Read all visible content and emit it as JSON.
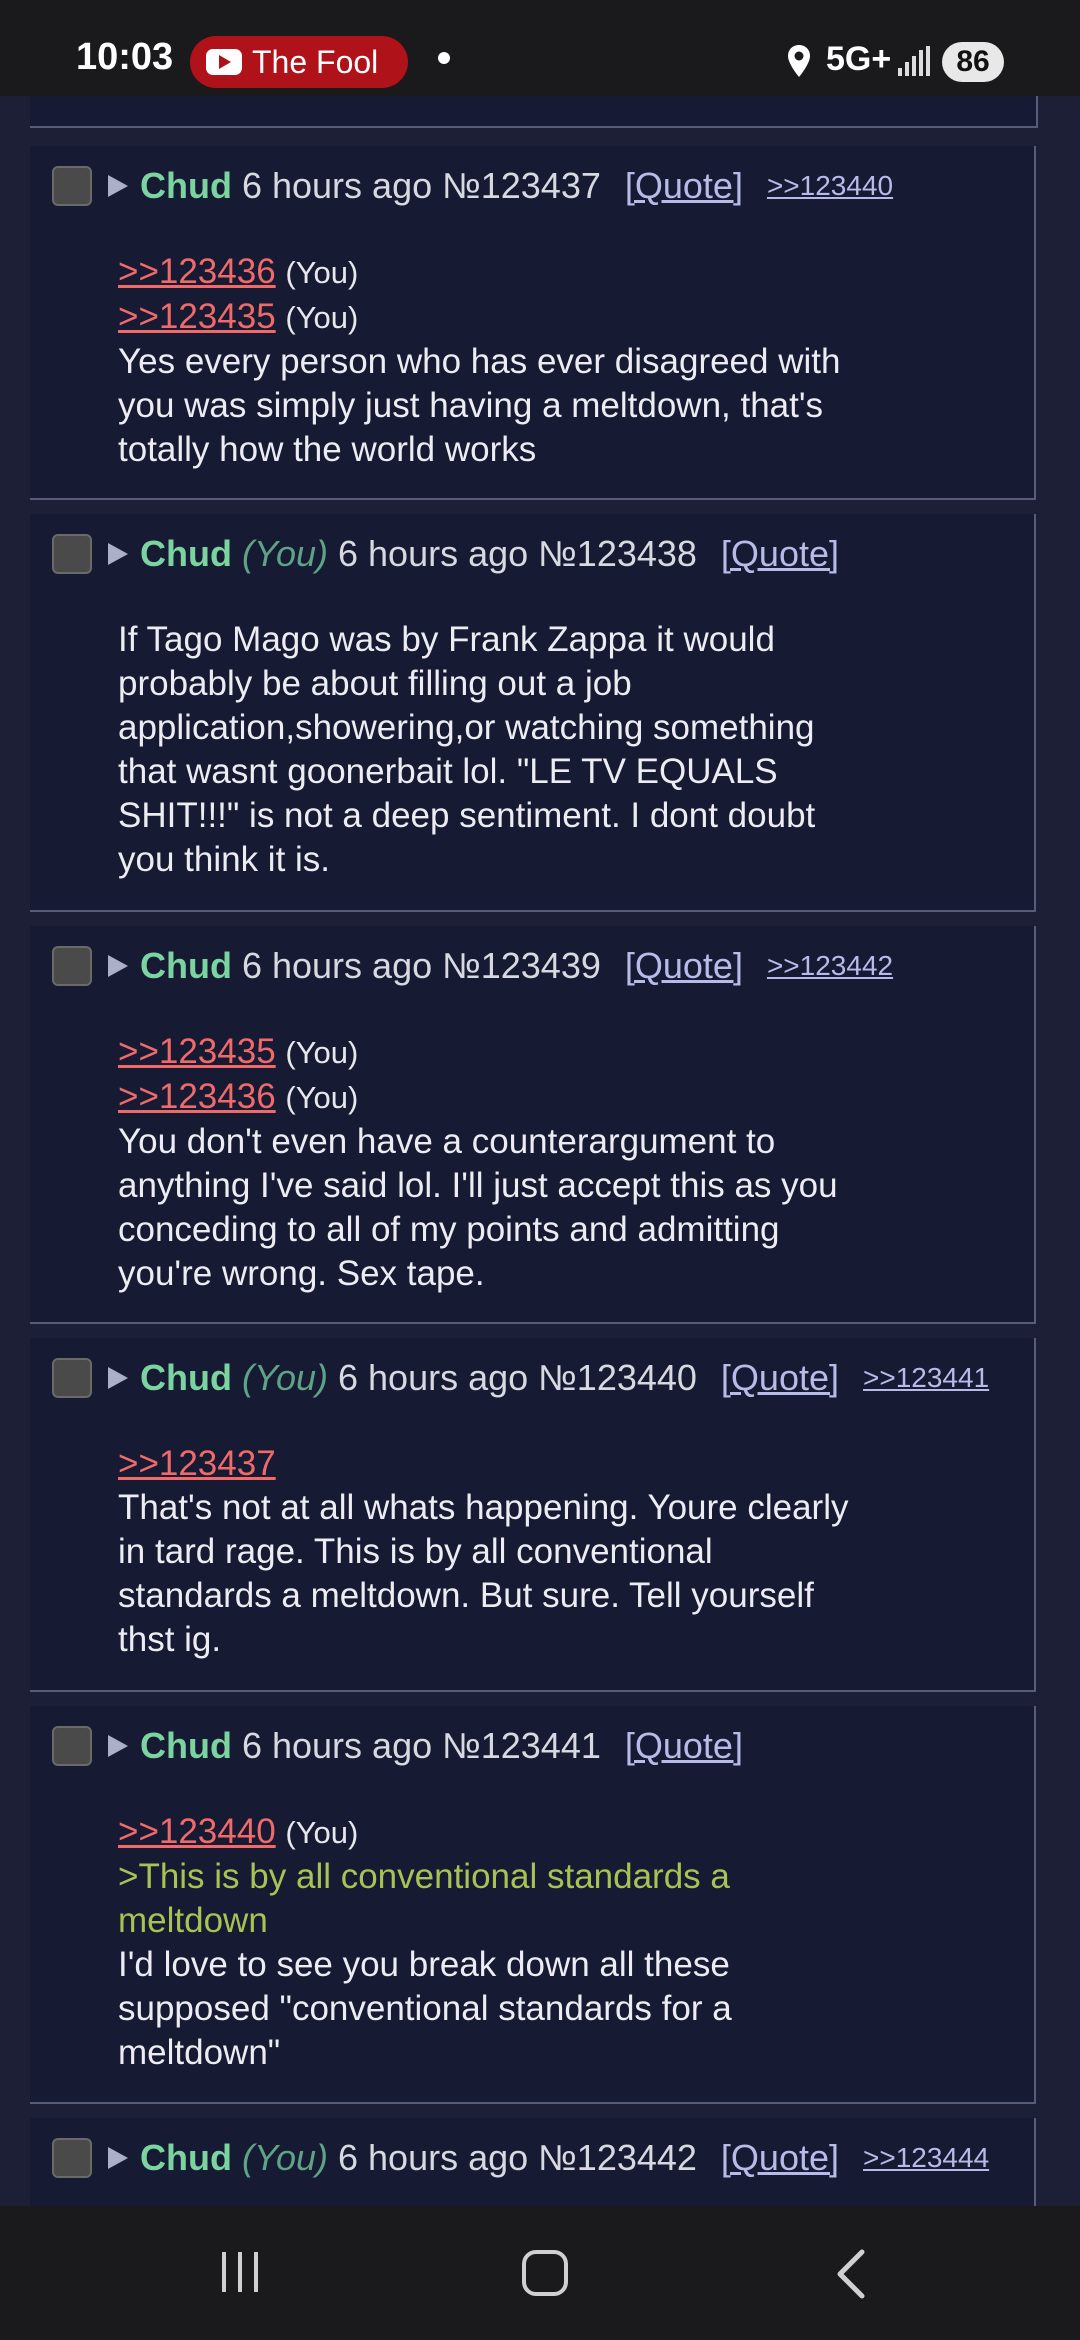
{
  "status_bar": {
    "time": "10:03",
    "notification_app": "The Fool",
    "network": "5G+",
    "battery": "86"
  },
  "posts": [
    {
      "name": "Chud",
      "you": "",
      "time": "6 hours ago",
      "number": "№123437",
      "quote_label": "[Quote]",
      "backlinks": [
        ">>123440"
      ],
      "lines": [
        {
          "type": "quote",
          "text": ">>123436",
          "suffix": "(You)"
        },
        {
          "type": "quote",
          "text": ">>123435",
          "suffix": "(You)"
        },
        {
          "type": "text",
          "text": "Yes every person who has ever disagreed with"
        },
        {
          "type": "text",
          "text": "you was simply just having a meltdown, that's"
        },
        {
          "type": "text",
          "text": "totally how the world works"
        }
      ]
    },
    {
      "name": "Chud",
      "you": "(You)",
      "time": "6 hours ago",
      "number": "№123438",
      "quote_label": "[Quote]",
      "backlinks": [],
      "lines": [
        {
          "type": "text",
          "text": "If Tago Mago was by Frank Zappa it would"
        },
        {
          "type": "text",
          "text": "probably be about filling out a job"
        },
        {
          "type": "text",
          "text": "application,showering,or watching something"
        },
        {
          "type": "text",
          "text": "that wasnt goonerbait lol. \"LE TV EQUALS"
        },
        {
          "type": "text",
          "text": "SHIT!!!\" is not a deep sentiment. I dont doubt"
        },
        {
          "type": "text",
          "text": "you think it is."
        }
      ]
    },
    {
      "name": "Chud",
      "you": "",
      "time": "6 hours ago",
      "number": "№123439",
      "quote_label": "[Quote]",
      "backlinks": [
        ">>123442"
      ],
      "lines": [
        {
          "type": "quote",
          "text": ">>123435",
          "suffix": "(You)"
        },
        {
          "type": "quote",
          "text": ">>123436",
          "suffix": "(You)"
        },
        {
          "type": "text",
          "text": "You don't even have a counterargument to"
        },
        {
          "type": "text",
          "text": "anything I've said lol. I'll just accept this as you"
        },
        {
          "type": "text",
          "text": "conceding to all of my points and admitting"
        },
        {
          "type": "text",
          "text": "you're wrong. Sex tape."
        }
      ]
    },
    {
      "name": "Chud",
      "you": "(You)",
      "time": "6 hours ago",
      "number": "№123440",
      "quote_label": "[Quote]",
      "backlinks": [
        ">>123441"
      ],
      "lines": [
        {
          "type": "quote",
          "text": ">>123437",
          "suffix": ""
        },
        {
          "type": "text",
          "text": "That's not at all whats happening. Youre clearly"
        },
        {
          "type": "text",
          "text": "in tard rage. This is by all conventional"
        },
        {
          "type": "text",
          "text": "standards a meltdown. But sure. Tell yourself"
        },
        {
          "type": "text",
          "text": "thst ig."
        }
      ]
    },
    {
      "name": "Chud",
      "you": "",
      "time": "6 hours ago",
      "number": "№123441",
      "quote_label": "[Quote]",
      "backlinks": [],
      "lines": [
        {
          "type": "quote",
          "text": ">>123440",
          "suffix": "(You)"
        },
        {
          "type": "green",
          "text": ">This is by all conventional standards a"
        },
        {
          "type": "green",
          "text": "meltdown"
        },
        {
          "type": "text",
          "text": "I'd love to see you break down all these"
        },
        {
          "type": "text",
          "text": "supposed \"conventional standards for a"
        },
        {
          "type": "text",
          "text": "meltdown\""
        }
      ]
    },
    {
      "name": "Chud",
      "you": "(You)",
      "time": "6 hours ago",
      "number": "№123442",
      "quote_label": "[Quote]",
      "backlinks": [
        ">>123444"
      ],
      "lines": []
    }
  ]
}
